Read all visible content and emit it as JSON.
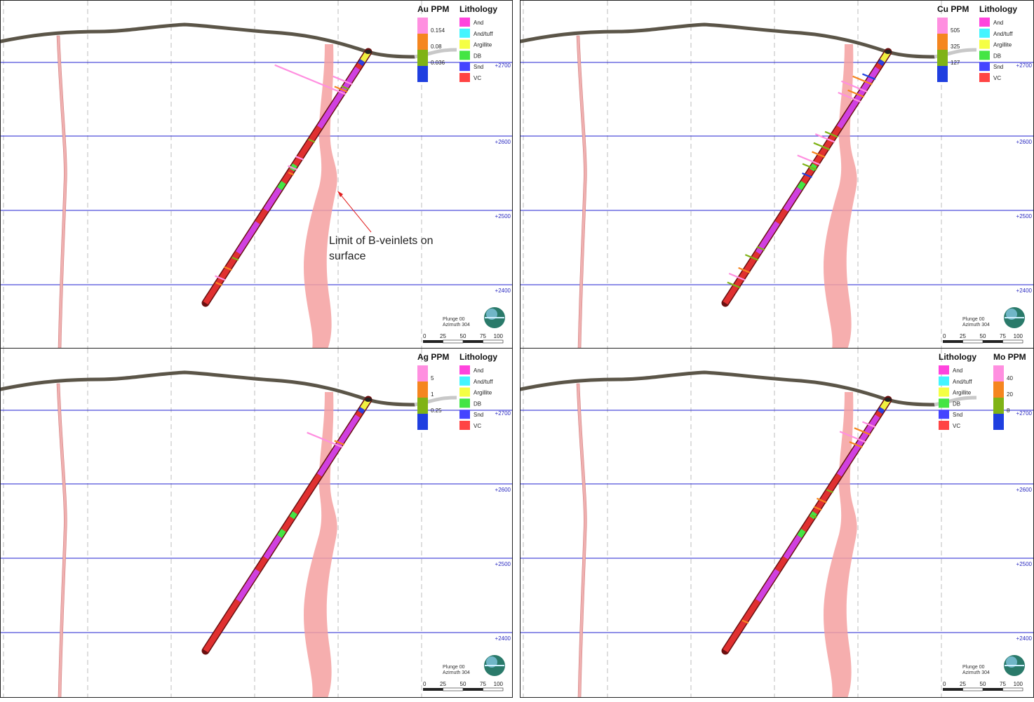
{
  "panels": [
    {
      "id": "au",
      "grade_title": "Au PPM",
      "grade_side": "left",
      "grade_bins": [
        {
          "color": "#ff8fe0",
          "label": "0.154"
        },
        {
          "color": "#f5861f",
          "label": "0.08"
        },
        {
          "color": "#7fb316",
          "label": "0.036"
        },
        {
          "color": "#1f3fe0",
          "label": ""
        }
      ]
    },
    {
      "id": "cu",
      "grade_title": "Cu PPM",
      "grade_side": "left",
      "grade_bins": [
        {
          "color": "#ff8fe0",
          "label": "505"
        },
        {
          "color": "#f5861f",
          "label": "325"
        },
        {
          "color": "#7fb316",
          "label": "127"
        },
        {
          "color": "#1f3fe0",
          "label": ""
        }
      ]
    },
    {
      "id": "ag",
      "grade_title": "Ag PPM",
      "grade_side": "left",
      "grade_bins": [
        {
          "color": "#ff8fe0",
          "label": "5"
        },
        {
          "color": "#f5861f",
          "label": "1"
        },
        {
          "color": "#7fb316",
          "label": "0.25"
        },
        {
          "color": "#1f3fe0",
          "label": ""
        }
      ]
    },
    {
      "id": "mo",
      "grade_title": "Mo PPM",
      "grade_side": "right",
      "grade_bins": [
        {
          "color": "#ff8fe0",
          "label": "40"
        },
        {
          "color": "#f5861f",
          "label": "20"
        },
        {
          "color": "#7fb316",
          "label": "8"
        },
        {
          "color": "#1f3fe0",
          "label": ""
        }
      ]
    }
  ],
  "lithology": {
    "title": "Lithology",
    "items": [
      {
        "label": "And",
        "color": "#ff44dd"
      },
      {
        "label": "And/tuff",
        "color": "#44f5ff"
      },
      {
        "label": "Argillite",
        "color": "#f5ff44"
      },
      {
        "label": "DB",
        "color": "#44e544"
      },
      {
        "label": "Snd",
        "color": "#4444ff"
      },
      {
        "label": "VC",
        "color": "#ff4444"
      }
    ]
  },
  "elevations": [
    "+2700",
    "+2600",
    "+2500",
    "+2400"
  ],
  "orientation": {
    "plunge": "Plunge 00",
    "azimuth": "Azimuth 304"
  },
  "scale_bar": {
    "ticks": [
      "0",
      "25",
      "50",
      "75",
      "100"
    ]
  },
  "annotation": {
    "text": "Limit of B-veinlets on\nsurface"
  },
  "colors": {
    "gridline": "#2020d0",
    "veinlet_zone": "#f4a0a0",
    "topography": "#5b5548",
    "hole_red": "#e03030",
    "hole_magenta": "#d040e0",
    "annotation_arrow": "#e02020"
  }
}
